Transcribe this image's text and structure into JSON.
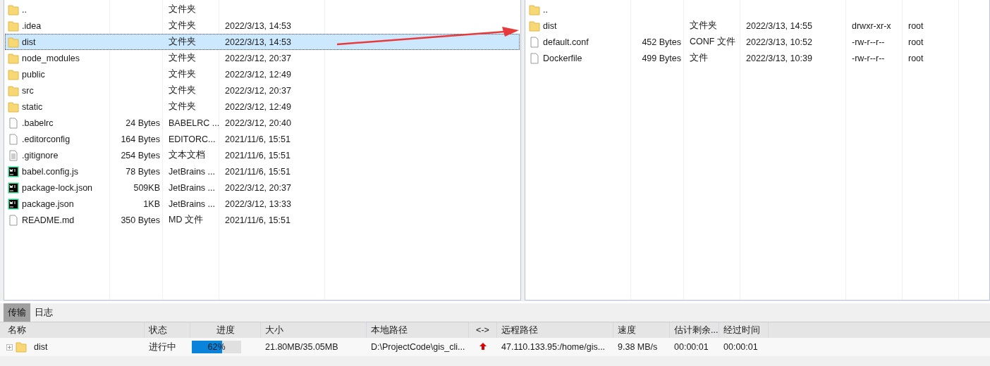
{
  "local_pane": {
    "rows": [
      {
        "kind": "folder",
        "selected": false,
        "cells": [
          "..",
          "",
          "文件夹",
          ""
        ]
      },
      {
        "kind": "folder",
        "selected": false,
        "cells": [
          ".idea",
          "",
          "文件夹",
          "2022/3/13, 14:53"
        ]
      },
      {
        "kind": "folder",
        "selected": true,
        "cells": [
          "dist",
          "",
          "文件夹",
          "2022/3/13, 14:53"
        ]
      },
      {
        "kind": "folder",
        "selected": false,
        "cells": [
          "node_modules",
          "",
          "文件夹",
          "2022/3/12, 20:37"
        ]
      },
      {
        "kind": "folder",
        "selected": false,
        "cells": [
          "public",
          "",
          "文件夹",
          "2022/3/12, 12:49"
        ]
      },
      {
        "kind": "folder",
        "selected": false,
        "cells": [
          "src",
          "",
          "文件夹",
          "2022/3/12, 20:37"
        ]
      },
      {
        "kind": "folder",
        "selected": false,
        "cells": [
          "static",
          "",
          "文件夹",
          "2022/3/12, 12:49"
        ]
      },
      {
        "kind": "file",
        "selected": false,
        "cells": [
          ".babelrc",
          "24 Bytes",
          "BABELRC ...",
          "2022/3/12, 20:40"
        ]
      },
      {
        "kind": "file",
        "selected": false,
        "cells": [
          ".editorconfig",
          "164 Bytes",
          "EDITORC...",
          "2021/11/6, 15:51"
        ]
      },
      {
        "kind": "text",
        "selected": false,
        "cells": [
          ".gitignore",
          "254 Bytes",
          "文本文档",
          "2021/11/6, 15:51"
        ]
      },
      {
        "kind": "webstorm",
        "selected": false,
        "cells": [
          "babel.config.js",
          "78 Bytes",
          "JetBrains ...",
          "2021/11/6, 15:51"
        ]
      },
      {
        "kind": "webstorm",
        "selected": false,
        "cells": [
          "package-lock.json",
          "509KB",
          "JetBrains ...",
          "2022/3/12, 20:37"
        ]
      },
      {
        "kind": "webstorm",
        "selected": false,
        "cells": [
          "package.json",
          "1KB",
          "JetBrains ...",
          "2022/3/12, 13:33"
        ]
      },
      {
        "kind": "file",
        "selected": false,
        "cells": [
          "README.md",
          "350 Bytes",
          "MD 文件",
          "2021/11/6, 15:51"
        ]
      }
    ]
  },
  "remote_pane": {
    "rows": [
      {
        "kind": "folder",
        "selected": false,
        "cells": [
          "..",
          "",
          "",
          "",
          "",
          ""
        ]
      },
      {
        "kind": "folder",
        "selected": false,
        "cells": [
          "dist",
          "",
          "文件夹",
          "2022/3/13, 14:55",
          "drwxr-xr-x",
          "root"
        ]
      },
      {
        "kind": "file",
        "selected": false,
        "cells": [
          "default.conf",
          "452 Bytes",
          "CONF 文件",
          "2022/3/13, 10:52",
          "-rw-r--r--",
          "root"
        ]
      },
      {
        "kind": "file",
        "selected": false,
        "cells": [
          "Dockerfile",
          "499 Bytes",
          "文件",
          "2022/3/13, 10:39",
          "-rw-r--r--",
          "root"
        ]
      }
    ]
  },
  "tabs": [
    {
      "label": "传输",
      "selected": true
    },
    {
      "label": "日志",
      "selected": false
    }
  ],
  "transfers": {
    "columns": [
      "名称",
      "状态",
      "进度",
      "大小",
      "本地路径",
      "<->",
      "远程路径",
      "速度",
      "估计剩余...",
      "经过时间"
    ],
    "rows": [
      {
        "kind": "folder",
        "expanded": false,
        "name": "dist",
        "status": "进行中",
        "level": 0.62,
        "progress": "62%",
        "size": "21.80MB/35.05MB",
        "local_path": "D:\\ProjectCode\\gis_cli...",
        "upload": true,
        "remote_path": "47.110.133.95:/home/gis...",
        "speed": "9.38 MB/s",
        "remaining": "00:00:01",
        "elapsed": "00:00:01"
      }
    ]
  }
}
